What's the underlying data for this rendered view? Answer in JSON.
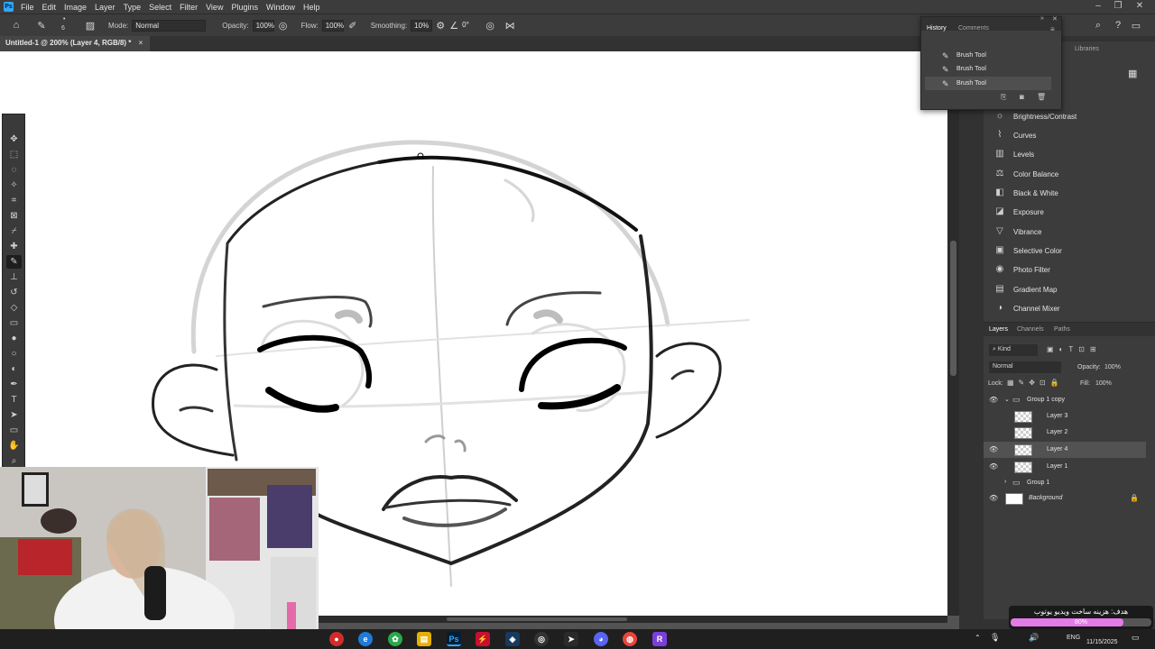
{
  "menu": {
    "items": [
      "File",
      "Edit",
      "Image",
      "Layer",
      "Type",
      "Select",
      "Filter",
      "View",
      "Plugins",
      "Window",
      "Help"
    ]
  },
  "options": {
    "mode_label": "Mode:",
    "mode_value": "Normal",
    "opacity_label": "Opacity:",
    "opacity_value": "100%",
    "flow_label": "Flow:",
    "flow_value": "100%",
    "smoothing_label": "Smoothing:",
    "smoothing_value": "10%",
    "angle_value": "0°",
    "brush_size": "6"
  },
  "document": {
    "tab_title": "Untitled-1 @ 200% (Layer 4, RGB/8) *"
  },
  "history": {
    "tab_active": "History",
    "tab_other": "Comments",
    "rows": [
      "Brush Tool",
      "Brush Tool",
      "Brush Tool"
    ]
  },
  "libraries_tab": "Libraries",
  "adjustments": [
    "Brightness/Contrast",
    "Curves",
    "Levels",
    "Color Balance",
    "Black & White",
    "Exposure",
    "Vibrance",
    "Selective Color",
    "Photo Filter",
    "Gradient Map",
    "Channel Mixer"
  ],
  "layers_panel": {
    "tabs": [
      "Layers",
      "Channels",
      "Paths"
    ],
    "kind_label": "Kind",
    "blend_mode": "Normal",
    "opacity_label": "Opacity:",
    "opacity_value": "100%",
    "lock_label": "Lock:",
    "fill_label": "Fill:",
    "fill_value": "100%",
    "layers": [
      "Group 1 copy",
      "Layer 3",
      "Layer 2",
      "Layer 4",
      "Layer 1",
      "Group 1",
      "Background"
    ],
    "selected": "Layer 4"
  },
  "overlay": {
    "donation_text": "هدف: هزینه ساخت ویدیو یوتوب",
    "donation_percent": "80%",
    "donation_progress": 0.8
  },
  "tray": {
    "lang": "ENG",
    "date": "11/15/2025"
  },
  "colors": {
    "accent": "#31a8ff",
    "donation_bar": "#e27be6"
  }
}
